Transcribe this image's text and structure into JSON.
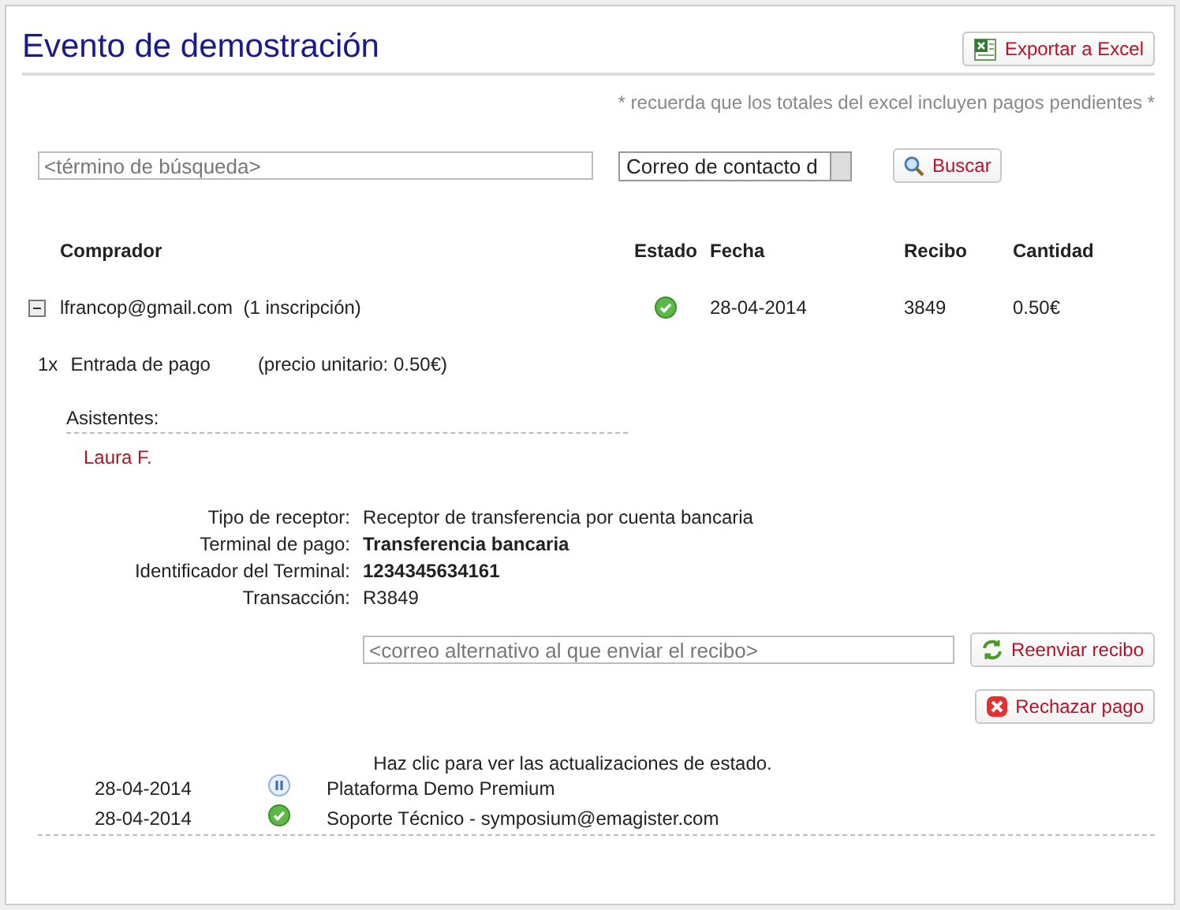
{
  "title": "Evento de demostración",
  "export_button": "Exportar a Excel",
  "note": "* recuerda que los totales del excel incluyen pagos pendientes *",
  "search": {
    "placeholder": "<término de búsqueda>",
    "filter": "Correo de contacto d",
    "button": "Buscar"
  },
  "table": {
    "columns": [
      "Comprador",
      "Estado",
      "Fecha",
      "Recibo",
      "Cantidad"
    ],
    "rows": [
      {
        "expanded": true,
        "buyer": "lfrancop@gmail.com",
        "registrations": "(1 inscripción)",
        "kind": "paid",
        "date": "28-04-2014",
        "receipt": "3849",
        "amount": "0.50€",
        "item": {
          "quantity": "1x",
          "name": "Entrada de pago",
          "unit_price": "(precio unitario: 0.50€)"
        },
        "attendees_label": "Asistentes:",
        "attendees": [
          "Laura F."
        ],
        "details": [
          {
            "label": "Tipo de receptor:",
            "value": "Receptor de transferencia por cuenta bancaria",
            "bold": false
          },
          {
            "label": "Terminal de pago:",
            "value": "Transferencia bancaria",
            "bold": true
          },
          {
            "label": "Identificador del Terminal:",
            "value": "1234345634161",
            "bold": true
          },
          {
            "label": "Transacción:",
            "value": "R3849",
            "bold": false
          }
        ],
        "resend": {
          "placeholder": "<correo alternativo al que enviar el recibo>",
          "button": "Reenviar recibo"
        },
        "reject_button": "Rechazar pago",
        "updates_hint": "Haz clic para ver las actualizaciones de estado.",
        "updates": [
          {
            "date": "28-04-2014",
            "kind": "pending",
            "text": "Plataforma Demo Premium"
          },
          {
            "date": "28-04-2014",
            "kind": "paid",
            "text": "Soporte Técnico - symposium@emagister.com"
          }
        ]
      }
    ]
  }
}
